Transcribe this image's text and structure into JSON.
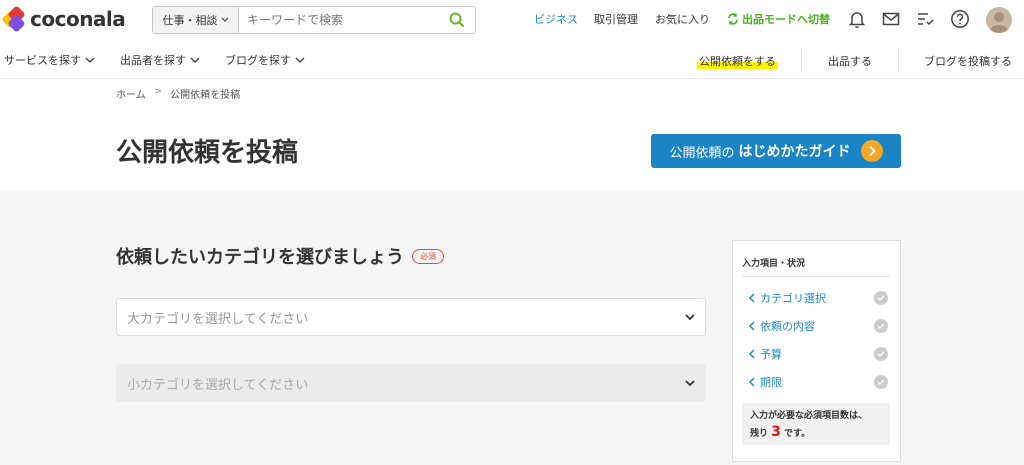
{
  "brand": {
    "name": "coconala"
  },
  "search": {
    "category": "仕事・相談",
    "placeholder": "キーワードで検索"
  },
  "header_links": {
    "business": "ビジネス",
    "transactions": "取引管理",
    "favorites": "お気に入り",
    "switch_mode": "出品モードへ切替"
  },
  "header_icons": [
    "bell-icon",
    "mail-icon",
    "checklist-icon",
    "help-icon",
    "avatar"
  ],
  "nav": {
    "find_services": "サービスを探す",
    "find_sellers": "出品者を探す",
    "find_blogs": "ブログを探す",
    "public_request": "公開依頼をする",
    "sell": "出品する",
    "post_blog": "ブログを投稿する"
  },
  "breadcrumb": {
    "home": "ホーム",
    "separator": ">",
    "current": "公開依頼を投稿"
  },
  "page": {
    "title": "公開依頼を投稿",
    "guide_prefix": "公開依頼の",
    "guide_bold": "はじめかたガイド"
  },
  "form": {
    "section_title": "依頼したいカテゴリを選びましょう",
    "required_badge": "必須",
    "major_category_placeholder": "大カテゴリを選択してください",
    "minor_category_placeholder": "小カテゴリを選択してください"
  },
  "sidebar": {
    "title": "入力項目・状況",
    "items": [
      {
        "label": "カテゴリ選択"
      },
      {
        "label": "依頼の内容"
      },
      {
        "label": "予算"
      },
      {
        "label": "期限"
      }
    ],
    "remaining_text_1": "入力が必要な必須項目数は、",
    "remaining_prefix": "残り",
    "remaining_count": "3",
    "remaining_suffix": "です。"
  },
  "colors": {
    "accent_blue": "#1b84c7",
    "link_blue": "#1a8ec8",
    "mode_green": "#4caf1f",
    "guide_arrow": "#f5a623",
    "required_red": "#e74c3c",
    "highlight_yellow": "#fff100"
  }
}
